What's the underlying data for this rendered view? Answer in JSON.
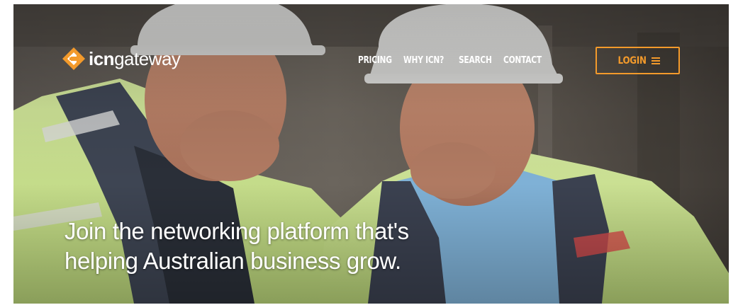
{
  "brand": {
    "name_bold": "icn",
    "name_light": "gateway",
    "logo_icon": "icn-logo-mark",
    "accent_color": "#f39a2b"
  },
  "nav": {
    "links": [
      {
        "label": "PRICING"
      },
      {
        "label": "WHY ICN?"
      },
      {
        "label": "SEARCH"
      },
      {
        "label": "CONTACT"
      }
    ],
    "login_label": "LOGIN",
    "login_icon": "menu-icon"
  },
  "hero": {
    "image": "two-construction-workers-in-hard-hats",
    "headline_line1": "Join the networking platform that's",
    "headline_line2": "helping Australian business grow."
  }
}
